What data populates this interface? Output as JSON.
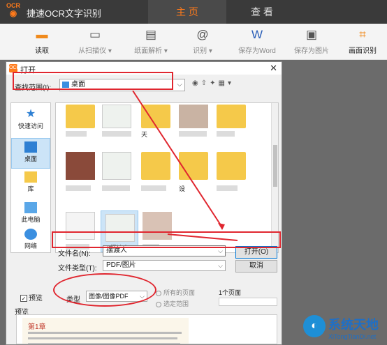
{
  "app": {
    "logo_text": "OCR",
    "title": "捷速OCR文字识别"
  },
  "nav": {
    "home": "主 页",
    "view": "查 看"
  },
  "toolbar": [
    {
      "label": "读取",
      "icon": "folder-icon"
    },
    {
      "label": "从扫描仪 ▾",
      "icon": "scanner-icon"
    },
    {
      "label": "纸面解析 ▾",
      "icon": "page-analyze-icon"
    },
    {
      "label": "识别 ▾",
      "icon": "recognize-icon"
    },
    {
      "label": "保存为Word",
      "icon": "word-icon"
    },
    {
      "label": "保存为图片",
      "icon": "image-save-icon"
    },
    {
      "label": "画面识别",
      "icon": "screen-capture-icon"
    }
  ],
  "dialog": {
    "title": "打开",
    "close": "✕",
    "look_in_label": "查找范围(I):",
    "look_in_value": "桌面",
    "places": [
      "快速访问",
      "桌面",
      "库",
      "此电脑",
      "网络"
    ],
    "files": {
      "partial_label_1": "天",
      "partial_label_2": "设",
      "selected_name": "摆渡人"
    },
    "filename_label": "文件名(N):",
    "filename_value": "摆渡人",
    "filetype_label": "文件类型(T):",
    "filetype_value": "PDF/图片",
    "open_button": "打开(O)",
    "cancel_button": "取消",
    "preview_checkbox": "预览",
    "preview_checked": true,
    "type_label": "类型",
    "type_value": "图像/图像PDF",
    "radio_all": "所有的页面",
    "radio_range": "选定范围",
    "page_count": "1个页面",
    "preview_label": "预览",
    "preview_chapter": "第1章"
  },
  "watermark": {
    "text": "系统天地",
    "url": "XiTongTianDi.net"
  },
  "colors": {
    "accent": "#ff7a1a",
    "annotation": "#e0262f",
    "selection": "#cce4f7"
  }
}
